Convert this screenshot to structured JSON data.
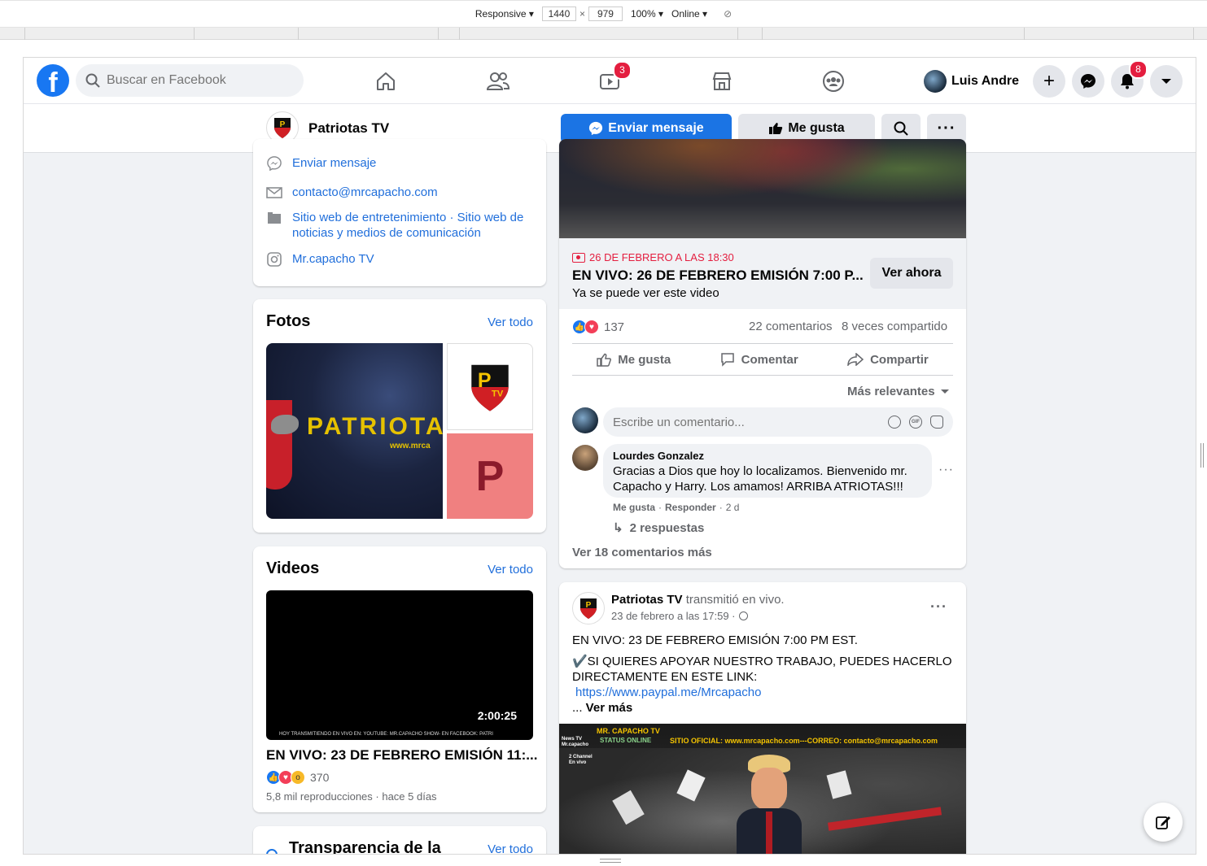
{
  "devtools": {
    "device": "Responsive",
    "width": "1440",
    "height": "979",
    "zoom": "100%",
    "throttle": "Online",
    "x_sep": "×"
  },
  "topnav": {
    "search_placeholder": "Buscar en Facebook",
    "watch_badge": "3",
    "profile_name": "Luis Andre",
    "notifications_badge": "8"
  },
  "pagebar": {
    "page_name": "Patriotas TV",
    "send_message": "Enviar mensaje",
    "like": "Me gusta"
  },
  "about": {
    "send_message": "Enviar mensaje",
    "email": "contacto@mrcapacho.com",
    "categories": "Sitio web de entretenimiento · Sitio web de noticias y medios de comunicación",
    "instagram": "Mr.capacho TV"
  },
  "photos": {
    "title": "Fotos",
    "see_all": "Ver todo",
    "banner_text": "PATRIOTAS",
    "banner_url": "www.mrca",
    "letter_tile": "P"
  },
  "videos": {
    "title": "Videos",
    "see_all": "Ver todo",
    "duration": "2:00:25",
    "ticker": "HOY TRANSMITIENDO EN VIVO EN: YOUTUBE: MR.CAPACHO SHOW- EN FACEBOOK: PATRI",
    "video_title": "EN VIVO: 23 DE FEBRERO EMISIÓN 11:...",
    "reactions_count": "370",
    "views": "5,8 mil reproducciones · hace 5 días"
  },
  "transparency": {
    "title": "Transparencia de la",
    "see_all": "Ver todo"
  },
  "post1": {
    "live_date": "26 DE FEBRERO A LAS 18:30",
    "live_title": "EN VIVO: 26 DE FEBRERO EMISIÓN 7:00 P...",
    "live_sub": "Ya se puede ver este video",
    "watch_now": "Ver ahora",
    "reactions_count": "137",
    "comments": "22 comentarios",
    "shares": "8 veces compartido",
    "like": "Me gusta",
    "comment": "Comentar",
    "share": "Compartir",
    "sort": "Más relevantes",
    "comment_placeholder": "Escribe un comentario...",
    "comment_author": "Lourdes Gonzalez",
    "comment_text": "Gracias a Dios que hoy lo localizamos. Bienvenido mr. Capacho y Harry. Los amamos! ARRIBA ATRIOTAS!!!",
    "comment_like": "Me gusta",
    "comment_reply": "Responder",
    "comment_time": "2 d",
    "replies": "2 respuestas",
    "more_comments": "Ver 18 comentarios más"
  },
  "post2": {
    "author": "Patriotas TV",
    "action": "transmitió en vivo.",
    "time": "23 de febrero a las 17:59 ·",
    "line1": "EN VIVO: 23 DE FEBRERO EMISIÓN 7:00 PM EST.",
    "line2": "✔️SI QUIERES APOYAR NUESTRO TRABAJO, PUEDES HACERLO DIRECTAMENTE EN ESTE LINK:",
    "link": "https://www.paypal.me/Mrcapacho",
    "see_more_prefix": "... ",
    "see_more": "Ver más",
    "thumb_channel": "MR. CAPACHO TV",
    "thumb_status": "STATUS ONLINE",
    "thumb_site": "SITIO OFICIAL: www.mrcapacho.com---CORREO: contacto@mrcapacho.com",
    "thumb_news": "News TV Mr.capacho",
    "thumb_channel2": "2 Channel En vivo"
  },
  "colors": {
    "brand": "#1877f2",
    "link": "#216fdb",
    "live_red": "#e41e3f",
    "background": "#f0f2f5"
  }
}
